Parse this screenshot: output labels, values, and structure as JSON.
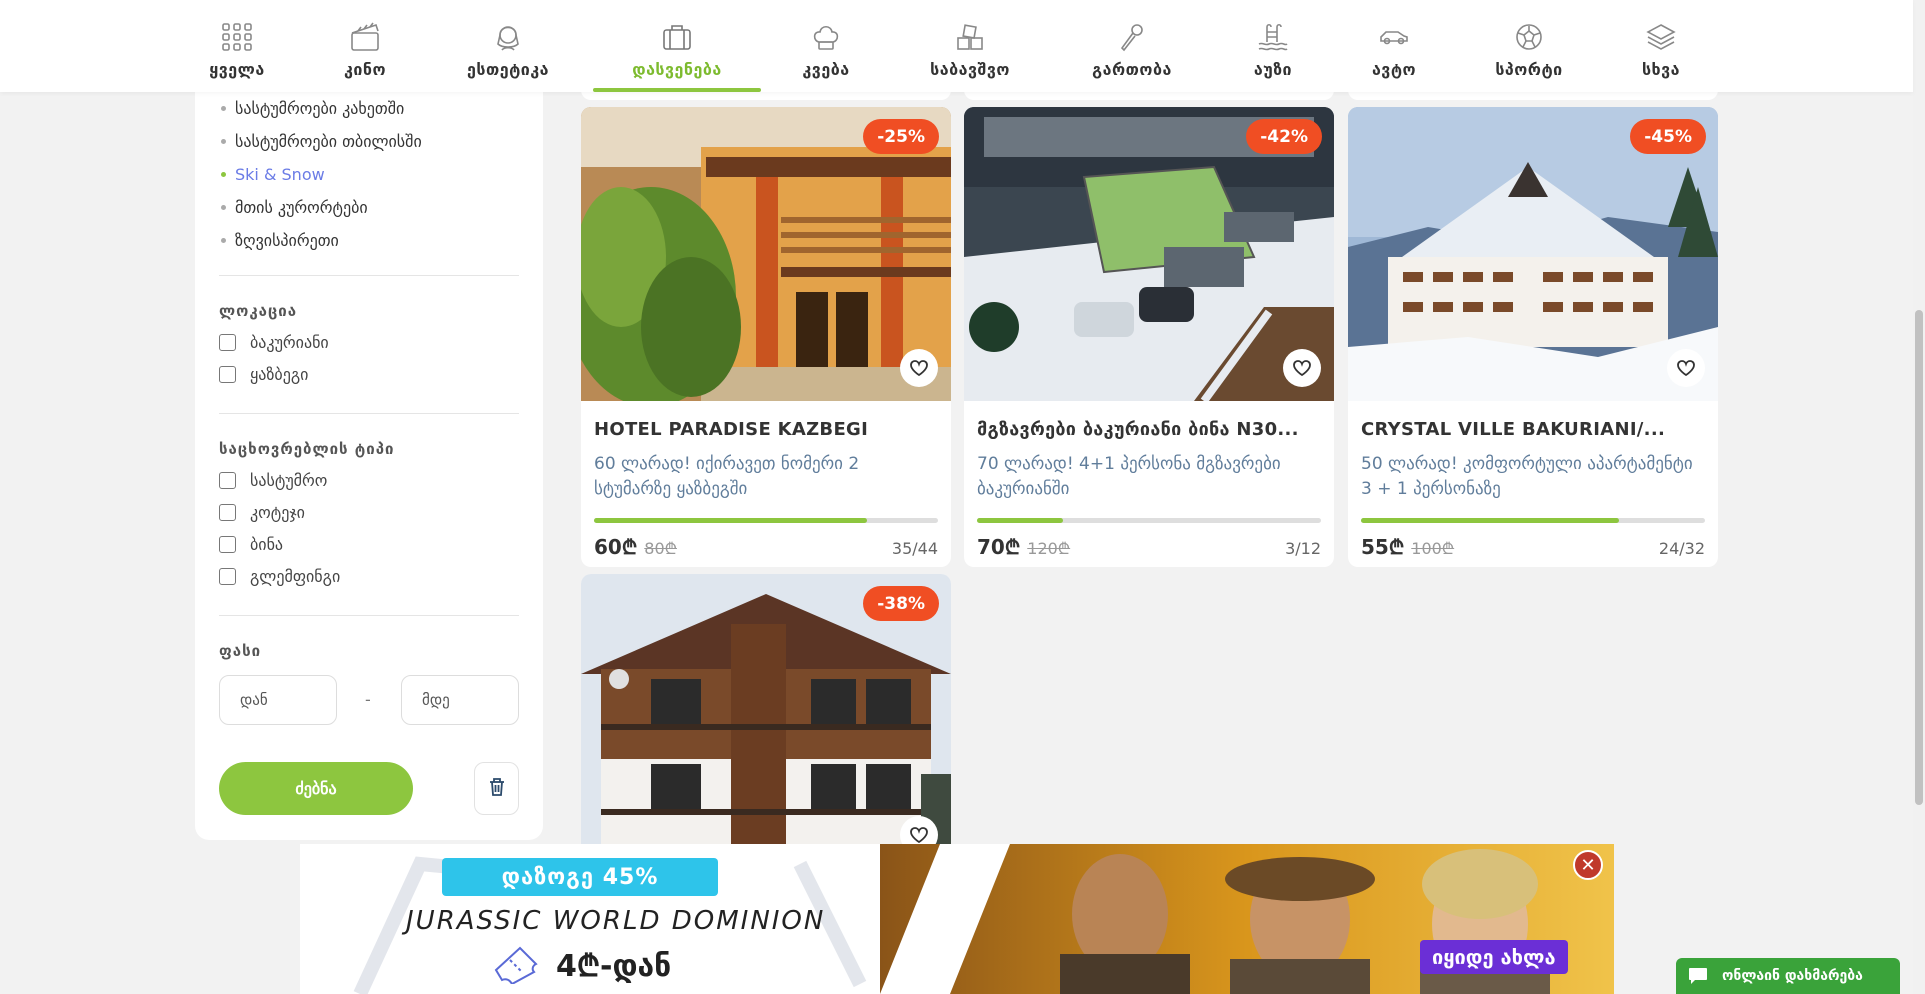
{
  "categories": [
    {
      "label": "ყველა",
      "icon": "grid-icon"
    },
    {
      "label": "კინო",
      "icon": "clapperboard-icon"
    },
    {
      "label": "ესთეტიკა",
      "icon": "woman-face-icon"
    },
    {
      "label": "დასვენება",
      "icon": "suitcase-icon",
      "active": true
    },
    {
      "label": "კვება",
      "icon": "chef-hat-icon"
    },
    {
      "label": "საბავშვო",
      "icon": "toy-blocks-icon"
    },
    {
      "label": "გართობა",
      "icon": "microphone-icon"
    },
    {
      "label": "აუზი",
      "icon": "pool-ladder-icon"
    },
    {
      "label": "ავტო",
      "icon": "car-icon"
    },
    {
      "label": "სპორტი",
      "icon": "soccer-ball-icon"
    },
    {
      "label": "სხვა",
      "icon": "layers-icon"
    }
  ],
  "sidebar": {
    "subcategories": [
      {
        "label": "სასტუმროები კახეთში"
      },
      {
        "label": "სასტუმროები თბილისში"
      },
      {
        "label": "Ski & Snow",
        "active": true
      },
      {
        "label": "მთის კურორტები"
      },
      {
        "label": "ზღვისპირეთი"
      }
    ],
    "location_title": "ლოკაცია",
    "locations": [
      "ბაკურიანი",
      "ყაზბეგი"
    ],
    "accommodation_title": "საცხოვრებლის ტიპი",
    "accommodation_types": [
      "სასტუმრო",
      "კოტეჯი",
      "ბინა",
      "გლემფინგი"
    ],
    "price_title": "ფასი",
    "price_from_placeholder": "დან",
    "price_to_placeholder": "მდე",
    "price_separator": "-",
    "search_label": "ძებნა"
  },
  "offers": [
    {
      "title": "HOTEL PARADISE KAZBEGI",
      "description": "60 ლარად! იქირავეთ ნომერი 2 სტუმარზე ყაზბეგში",
      "discount": "-25%",
      "price": "60₾",
      "old_price": "80₾",
      "sold": "35/44",
      "progress": 0.795
    },
    {
      "title": "მგზავრები ბაკურიანი ბინა N30...",
      "description": "70 ლარად! 4+1 პერსონა მგზავრები ბაკურიანში",
      "discount": "-42%",
      "price": "70₾",
      "old_price": "120₾",
      "sold": "3/12",
      "progress": 0.25
    },
    {
      "title": "CRYSTAL VILLE BAKURIANI/...",
      "description": "50 ლარად! კომფორტული აპარტამენტი 3 + 1 პერსონაზე",
      "discount": "-45%",
      "price": "55₾",
      "old_price": "100₾",
      "sold": "24/32",
      "progress": 0.75
    },
    {
      "title": "",
      "description": "",
      "discount": "-38%",
      "price": "",
      "old_price": "",
      "sold": "",
      "progress": 0
    }
  ],
  "banner": {
    "discount_text": "დაზოგე 45%",
    "movie_title": "JURASSIC WORLD DOMINION",
    "price_text": "4₾-დან",
    "cta": "იყიდე ახლა",
    "close": "✕"
  },
  "chat": {
    "label": "ონლაინ დახმარება"
  },
  "colors": {
    "accent": "#8dc63f",
    "discount": "#f04e23",
    "link": "#6b7ce6",
    "banner_cta": "#6b2fd6",
    "chat": "#3aa33a"
  }
}
